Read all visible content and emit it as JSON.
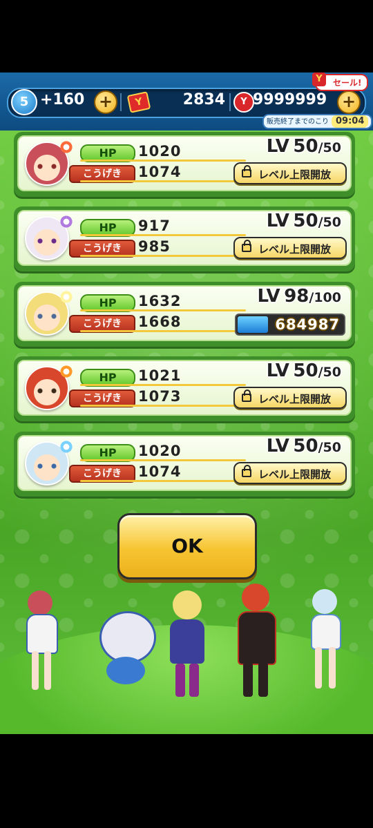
{
  "topbar": {
    "stamina_level": "5",
    "stamina_count": "+160",
    "plus_symbol": "+",
    "ycoin_icon": "Y",
    "ycoin_amount": "2834",
    "ymoney_icon": "Y",
    "ymoney_amount": "9999999",
    "sale_label": "セール!",
    "sale_icon": "Y",
    "timer_label": "販売終了までのこり",
    "timer_value": "09:04"
  },
  "stat_labels": {
    "hp": "HP",
    "attack": "こうげき",
    "lv": "LV"
  },
  "unlock_label": "レベル上限開放",
  "characters": [
    {
      "hp": "1020",
      "attack": "1074",
      "level": "50",
      "max_level": "/50",
      "hair": "#c9505a",
      "eye": "#8a2a2a",
      "spark": "#ff6a3a"
    },
    {
      "hp": "917",
      "attack": "985",
      "level": "50",
      "max_level": "/50",
      "hair": "#efe7f3",
      "eye": "#6a2b8a",
      "spark": "#b07adf"
    },
    {
      "hp": "1632",
      "attack": "1668",
      "level": "98",
      "max_level": "/100",
      "hair": "#f3dc7a",
      "eye": "#4a6a9a",
      "spark": "#fff4a0",
      "exp": "684987",
      "exp_progress": 0.28
    },
    {
      "hp": "1021",
      "attack": "1073",
      "level": "50",
      "max_level": "/50",
      "hair": "#d8462b",
      "eye": "#3a2a1a",
      "spark": "#ff9a2a"
    },
    {
      "hp": "1020",
      "attack": "1074",
      "level": "50",
      "max_level": "/50",
      "hair": "#cfe6f5",
      "eye": "#3a6aa8",
      "spark": "#7ad0ff"
    }
  ],
  "ok_label": "OK",
  "colors": {
    "accent_green": "#55b72c",
    "button_yellow": "#f7c431",
    "hp_green": "#63c72c",
    "attack_red": "#b7321f"
  }
}
